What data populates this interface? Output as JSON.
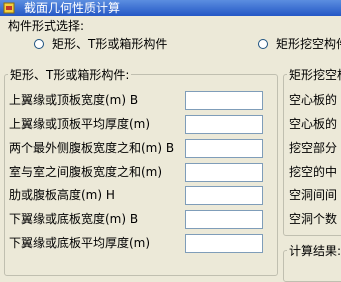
{
  "window": {
    "title": "截面几何性质计算"
  },
  "shape_section": {
    "label": "构件形式选择:",
    "options": [
      {
        "label": "矩形、T形或箱形构件",
        "selected": false
      },
      {
        "label": "矩形挖空构件",
        "selected": false
      }
    ]
  },
  "rect_t_box": {
    "label": "矩形、T形或箱形构件:",
    "rows": [
      {
        "label": "上翼缘或顶板宽度(m) B",
        "value": ""
      },
      {
        "label": "上翼缘或顶板平均厚度(m)",
        "value": ""
      },
      {
        "label": "两个最外侧腹板宽度之和(m) B",
        "value": ""
      },
      {
        "label": "室与室之间腹板宽度之和(m)",
        "value": ""
      },
      {
        "label": "肋或腹板高度(m) H",
        "value": ""
      },
      {
        "label": "下翼缘或底板宽度(m) B",
        "value": ""
      },
      {
        "label": "下翼缘或底板平均厚度(m)",
        "value": ""
      }
    ]
  },
  "hollow": {
    "label": "矩形挖空构",
    "rows": [
      {
        "label": "空心板的"
      },
      {
        "label": "空心板的"
      },
      {
        "label": "挖空部分"
      },
      {
        "label": "挖空的中"
      },
      {
        "label": "空洞间间"
      },
      {
        "label": "空洞个数"
      }
    ]
  },
  "results": {
    "label": "计算结果:"
  }
}
